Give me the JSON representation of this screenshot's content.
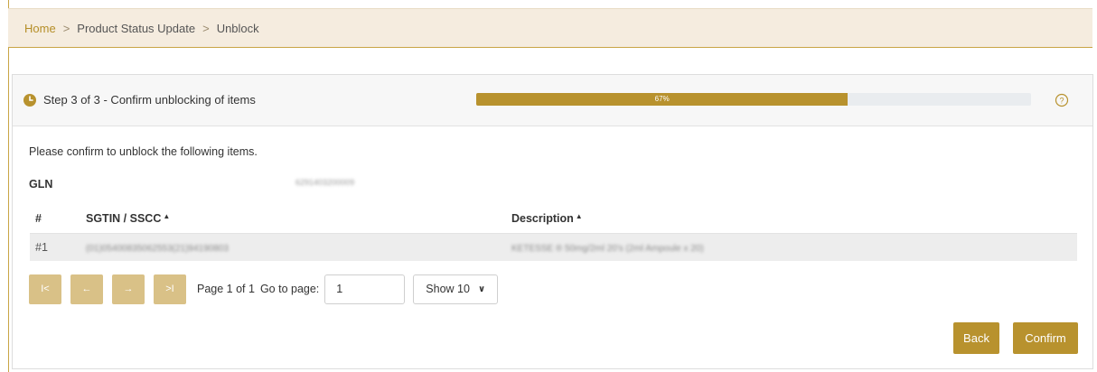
{
  "breadcrumb": {
    "home": "Home",
    "sep": ">",
    "section": "Product Status Update",
    "current": "Unblock"
  },
  "step": {
    "title": "Step 3 of 3 - Confirm unblocking of items",
    "progress_label": "67%",
    "progress_fraction": 0.67
  },
  "intro_text": "Please confirm to unblock the following items.",
  "gln": {
    "label": "GLN",
    "value": "6291403200009"
  },
  "table": {
    "headers": [
      "#",
      "SGTIN / SSCC",
      "Description"
    ],
    "sort_caret": "▲",
    "rows": [
      {
        "index": "#1",
        "sgtin": "(01)05400835062553(21)94190803",
        "description": "KETESSE ® 50mg/2ml 20's (2ml Ampoule x 20)"
      }
    ]
  },
  "pager": {
    "first": "I<",
    "prev": "←",
    "next": "→",
    "last": ">I",
    "page_info": "Page 1 of 1",
    "goto_label": "Go to page:",
    "goto_value": "1",
    "show_value": "Show 10"
  },
  "actions": {
    "back": "Back",
    "confirm": "Confirm"
  },
  "colors": {
    "accent": "#b8922e",
    "pager_button": "#d9c187",
    "breadcrumb_bg": "#f5ecdf"
  }
}
